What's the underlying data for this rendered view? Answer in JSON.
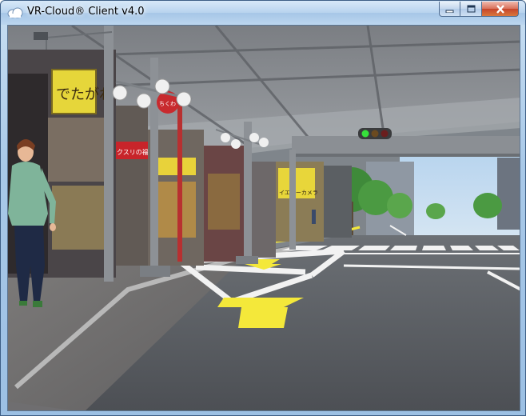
{
  "window": {
    "title": "VR-Cloud® Client v4.0",
    "controls": {
      "minimize_icon": "minimize-icon",
      "maximize_icon": "maximize-icon",
      "close_icon": "close-icon"
    }
  },
  "scene": {
    "signs": [
      {
        "id": "yellow-shop-sign",
        "text": "でたがね"
      },
      {
        "id": "pharmacy-sign",
        "text": "クスリの福太郎"
      },
      {
        "id": "camera-sign",
        "text": "イエローカメラ"
      },
      {
        "id": "red-round-sign",
        "text": "ちくわ"
      }
    ],
    "traffic_light": {
      "lit": "green"
    },
    "colors": {
      "sky": "#a8c8e8",
      "asphalt": "#55585c",
      "road_arrow": "#f4e83a",
      "road_marking": "#f2f2f2",
      "sidewalk": "#8c8c8c"
    }
  }
}
